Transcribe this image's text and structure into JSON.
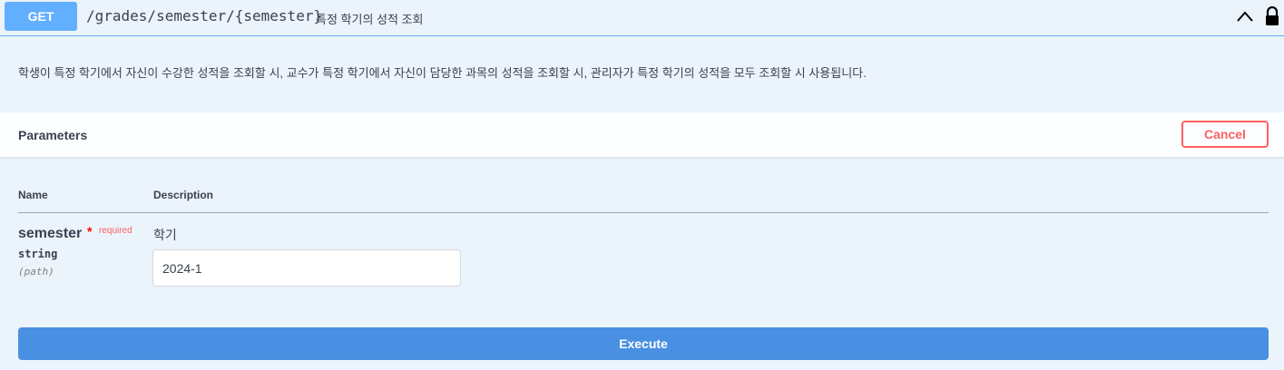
{
  "operation": {
    "method": "GET",
    "path": "/grades/semester/{semester}",
    "summary": "특정 학기의 성적 조회",
    "description": "학생이 특정 학기에서 자신이 수강한 성적을 조회할 시, 교수가 특정 학기에서 자신이 담당한 과목의 성적을 조회할 시, 관리자가 특정 학기의 성적을 모두 조회할 시 사용됩니다.",
    "method_color": "#61affe"
  },
  "parameters": {
    "title": "Parameters",
    "cancel_label": "Cancel",
    "columns": {
      "name": "Name",
      "description": "Description"
    },
    "items": [
      {
        "name": "semester",
        "required_marker": "*",
        "required_label": "required",
        "type": "string",
        "in": "(path)",
        "description": "학기",
        "value": "2024-1"
      }
    ]
  },
  "execute_label": "Execute",
  "icons": {
    "collapse": "chevron-up-icon",
    "lock": "lock-icon"
  },
  "colors": {
    "accent": "#61affe",
    "execute": "#4990e2",
    "cancel": "#ff6060",
    "background": "#ebf3fb"
  }
}
